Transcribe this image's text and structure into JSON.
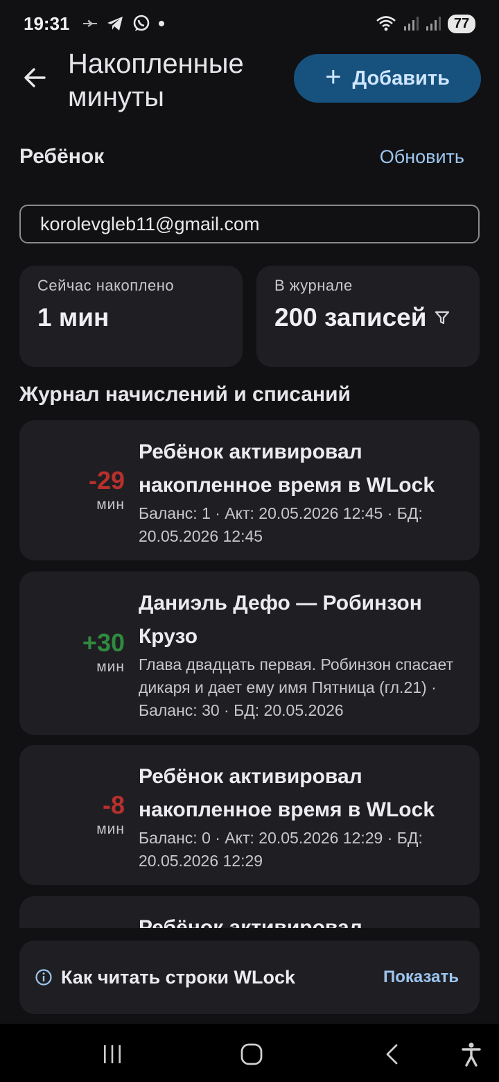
{
  "status_bar": {
    "time": "19:31",
    "battery": "77",
    "icons": [
      "plane-notification-icon",
      "telegram-icon",
      "whatsapp-icon",
      "dot-icon",
      "wifi-icon",
      "signal-icon",
      "signal-icon-2"
    ]
  },
  "header": {
    "title": "Накопленные минуты",
    "add_button": "Добавить"
  },
  "child_section": {
    "label": "Ребёнок",
    "refresh_link": "Обновить",
    "email_value": "korolevgleb11@gmail.com"
  },
  "stats": {
    "accumulated_label": "Сейчас накоплено",
    "accumulated_value": "1 мин",
    "journal_label": "В журнале",
    "journal_value": "200 записей"
  },
  "journal": {
    "title": "Журнал начислений и списаний",
    "entries": [
      {
        "amount": "-29",
        "unit": "мин",
        "title": "Ребёнок активировал накопленное время в WLock",
        "subtitle": "Баланс: 1 · Акт: 20.05.2026 12:45 · БД: 20.05.2026 12:45"
      },
      {
        "amount": "+30",
        "unit": "мин",
        "title": "Даниэль Дефо — Робинзон Крузо",
        "subtitle": "Глава двадцать первая. Робинзон спасает дикаря и дает ему имя Пятница (гл.21) · Баланс: 30 · БД: 20.05.2026"
      },
      {
        "amount": "-8",
        "unit": "мин",
        "title": "Ребёнок активировал накопленное время в WLock",
        "subtitle": "Баланс: 0 · Акт: 20.05.2026 12:29 · БД: 20.05.2026 12:29"
      },
      {
        "amount": "",
        "unit": "",
        "title": "Ребёнок активировал",
        "subtitle": ""
      }
    ]
  },
  "hint": {
    "text": "Как читать строки WLock",
    "show_link": "Показать"
  },
  "colors": {
    "background": "#111113",
    "card": "#1f1f23",
    "accent_button": "#17527f",
    "link": "#9dc6f0",
    "negative": "#b8302c",
    "positive": "#2f8a3e"
  }
}
